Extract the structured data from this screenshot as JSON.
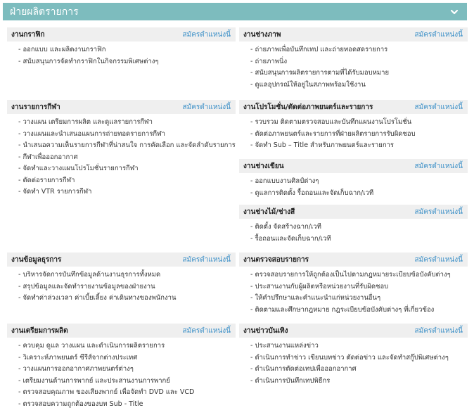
{
  "header": {
    "title": "ฝ่ายผลิตรายการ",
    "expand_icon": "chevron-down-icon"
  },
  "apply_label": "สมัครตำแหน่งนี้",
  "sections": [
    {
      "title": "งานกราฟิก",
      "items": [
        "ออกแบบ และผลิตงานกราฟิก",
        "สนับสนุนการจัดทำกราฟิกในกิจกรรมพิเศษต่างๆ"
      ]
    },
    {
      "title": "งานช่างภาพ",
      "items": [
        "ถ่ายภาพเพื่อบันทึกเทป และถ่ายทอดสดรายการ",
        "ถ่ายภาพนิ่ง",
        "สนับสนุนการผลิตรายการตามที่ได้รับมอบหมาย",
        "ดูแลอุปกรณ์ให้อยู่ในสภาพพร้อมใช้งาน"
      ]
    },
    {
      "title": "งานรายการกีฬา",
      "items": [
        "วางแผน เตรียมการผลิต และดูแลรายการกีฬา",
        "วางแผนและนำเสนอแผนการถ่ายทอดรายการกีฬา",
        "นำเสนอความเห็นรายการกีฬาที่น่าสนใจ การคัดเลือก และจัดลำดับรายการ",
        "กีฬาเพื่อออกอากาศ",
        "จัดทำและวางแผนโปรโมชั่นรายการกีฬา",
        "ตัดต่อรายการกีฬา",
        "จัดทำ VTR รายการกีฬา"
      ]
    },
    {
      "title": "งานโปรโมชั่น/ตัดต่อภาพยนตร์และรายการ",
      "items": [
        "รวบรวม ติดตามตรวจสอบและบันทึกแผนงานโปรโมชั่น",
        "ตัดต่อภาพยนตร์และรายการที่ฝ่ายผลิตรายการรับผิดชอบ",
        "จัดทำ Sub – Title สำหรับภาพยนตร์และรายการ"
      ]
    },
    {
      "title": "งานช่างเขียน",
      "items": [
        "ออกแบบงานศิลป์ต่างๆ",
        "ดูแลการติดตั้ง รื้อถอนและจัดเก็บฉาก/เวที"
      ]
    },
    {
      "title": "งานช่างไม้/ช่างสี",
      "items": [
        "ติดตั้ง จัดสร้างฉาก/เวที",
        "รื้อถอนและจัดเก็บฉาก/เวที"
      ]
    },
    {
      "title": "งานข้อมูลธุรการ",
      "items": [
        "บริหารจัดการบันทึกข้อมูลด้านงานธุรการทั้งหมด",
        "สรุปข้อมูลและจัดทำรายงานข้อมูลของฝ่ายงาน",
        "จัดทำค่าล่วงเวลา ค่าเบี้ยเลี้ยง ค่าเดินทางของพนักงาน"
      ]
    },
    {
      "title": "งานตรวจสอบรายการ",
      "items": [
        "ตรวจสอบรายการให้ถูกต้องเป็นไปตามกฎหมายระเบียบข้อบังคับต่างๆ",
        "ประสานงานกับผู้ผลิตหรือหน่วยงานที่รับผิดชอบ",
        "ให้คำปรึกษาและคำแนะนำแก่หน่วยงานอื่นๆ",
        "ติดตามและศึกษากฎหมาย กฎระเบียบข้อบังคับต่างๆ ที่เกี่ยวข้อง"
      ]
    },
    {
      "title": "งานเตรียมการผลิต",
      "items": [
        "ควบคุม ดูแล วางแผน และดำเนินการผลิตรายการ",
        "วิเคราะห์ภาพยนตร์ ซีรีส์จากต่างประเทศ",
        "วางแผนการออกอากาศภาพยนตร์ต่างๆ",
        "เตรียมงานด้านการพากย์ และประสานงานการพากย์",
        "ตรวจสอบคุณภาพ ของเสียงพากย์ เพื่อจัดทำ DVD และ VCD",
        "ตรวจสอบความถูกต้องของบท Sub - Title"
      ]
    },
    {
      "title": "งานข่าวบันเทิง",
      "items": [
        "ประสานงานแหล่งข่าว",
        "ดำเนินการทำข่าว เขียนบทข่าว ตัดต่อข่าว และจัดทำสกู๊ปพิเศษต่างๆ",
        "ดำเนินการตัดต่อเทปเพื่อออกอากาศ",
        "ดำเนินการบันทึกเทปพิธีกร"
      ]
    }
  ]
}
